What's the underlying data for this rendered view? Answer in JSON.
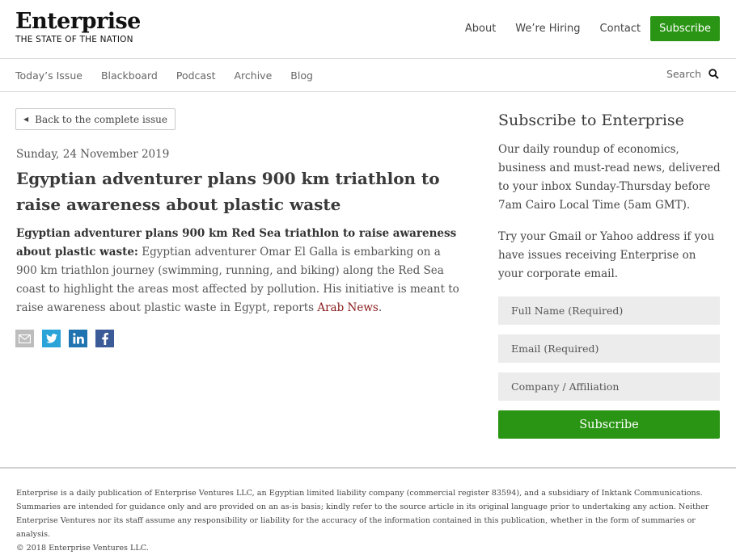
{
  "header": {
    "logo_word": "Enterprise",
    "logo_tagline": "THE STATE OF THE NATION",
    "nav": [
      "About",
      "We’re Hiring",
      "Contact"
    ],
    "subscribe_label": "Subscribe"
  },
  "subnav": {
    "items": [
      "Today’s Issue",
      "Blackboard",
      "Podcast",
      "Archive",
      "Blog"
    ],
    "search_label": "Search"
  },
  "article": {
    "back_label": "Back to the complete issue",
    "date": "Sunday, 24 November 2019",
    "headline": "Egyptian adventurer plans 900 km triathlon to raise awareness about plastic waste",
    "lead_bold": "Egyptian adventurer plans 900 km Red Sea triathlon to raise awareness about plastic waste:",
    "body": " Egyptian adventurer Omar El Galla is embarking on a 900 km triathlon journey (swimming, running, and biking) along the Red Sea coast to highlight the areas most affected by pollution. His initiative is meant to raise awareness about plastic waste in Egypt, reports ",
    "source_link": "Arab News",
    "body_end": ".",
    "share_icons": [
      "mail-icon",
      "twitter-icon",
      "linkedin-icon",
      "facebook-icon"
    ]
  },
  "sidebar": {
    "title": "Subscribe to Enterprise",
    "text1": "Our daily roundup of economics, business and must-read news, delivered to your inbox Sunday-Thursday before 7am Cairo Local Time (5am GMT).",
    "text2": "Try your Gmail or Yahoo address if you have issues receiving Enterprise on your corporate email.",
    "fields": [
      "Full Name (Required)",
      "Email (Required)",
      "Company / Affiliation"
    ],
    "subscribe_label": "Subscribe"
  },
  "footer": {
    "text": "Enterprise is a daily publication of Enterprise Ventures LLC, an Egyptian limited liability company (commercial register 83594), and a subsidiary of Inktank Communications. Summaries are intended for guidance only and are provided on an as-is basis; kindly refer to the source article in its original language prior to undertaking any action. Neither Enterprise Ventures nor its staff assume any responsibility or liability for the accuracy of the information contained in this publication, whether in the form of summaries or analysis.",
    "copyright": "© 2018 Enterprise Ventures LLC."
  },
  "colors": {
    "accent_green": "#2a9514",
    "link_red": "#8b1a1a"
  }
}
